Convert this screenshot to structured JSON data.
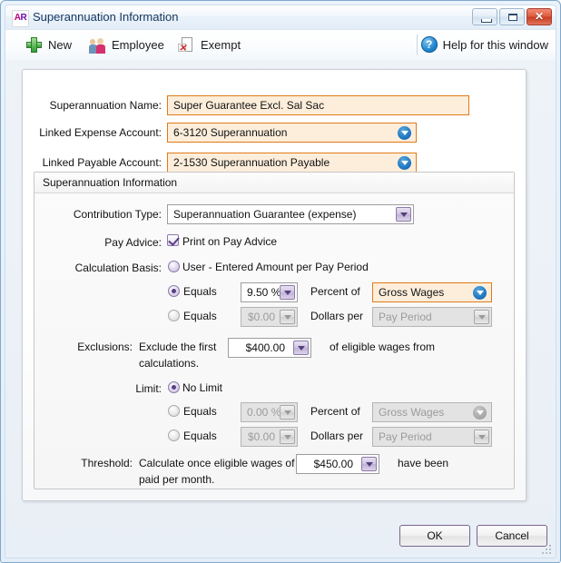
{
  "window": {
    "app_icon_text": "AR",
    "title": "Superannuation Information",
    "controls": {
      "minimize": "minimize-button",
      "maximize": "maximize-button",
      "close": "✕"
    }
  },
  "toolbar": {
    "new_label": "New",
    "employee_label": "Employee",
    "exempt_label": "Exempt",
    "help_label": "Help for this window",
    "help_glyph": "?"
  },
  "form": {
    "name_label": "Superannuation Name:",
    "name_value": "Super Guarantee Excl. Sal Sac",
    "expense_label": "Linked Expense Account:",
    "expense_value": "6-3120 Superannuation",
    "payable_label": "Linked Payable Account:",
    "payable_value": "2-1530 Superannuation Payable"
  },
  "group": {
    "title": "Superannuation Information",
    "contribution_label": "Contribution Type:",
    "contribution_value": "Superannuation Guarantee (expense)",
    "pay_advice_label": "Pay Advice:",
    "pay_advice_checkbox_label": "Print on Pay Advice",
    "calc_label": "Calculation Basis:",
    "calc_option_user": "User  - Entered Amount per Pay Period",
    "calc_equals_1": "Equals",
    "calc_percent_value": "9.50 %",
    "calc_percent_of_label": "Percent of",
    "calc_percent_of_value": "Gross Wages",
    "calc_equals_2": "Equals",
    "calc_dollars_value": "$0.00",
    "calc_dollars_per_label": "Dollars per",
    "calc_dollars_per_value": "Pay Period",
    "exclusions_label": "Exclusions:",
    "exclusions_prefix": "Exclude the first",
    "exclusions_value": "$400.00",
    "exclusions_suffix": "of eligible wages from",
    "exclusions_suffix2": "calculations.",
    "limit_label": "Limit:",
    "limit_option_none": "No Limit",
    "limit_equals_1": "Equals",
    "limit_percent_value": "0.00 %",
    "limit_percent_of_label": "Percent of",
    "limit_percent_of_value": "Gross Wages",
    "limit_equals_2": "Equals",
    "limit_dollars_value": "$0.00",
    "limit_dollars_per_label": "Dollars per",
    "limit_dollars_per_value": "Pay Period",
    "threshold_label": "Threshold:",
    "threshold_prefix": "Calculate once eligible wages of",
    "threshold_value": "$450.00",
    "threshold_suffix": "have been",
    "threshold_suffix2": "paid per month."
  },
  "footer": {
    "ok_label": "OK",
    "cancel_label": "Cancel"
  },
  "colors": {
    "field_border_active": "#e07a18",
    "field_bg_active": "#fdeedb",
    "accent_purple": "#5b3f86",
    "accent_blue": "#1f78c2",
    "title_text": "#13365e"
  }
}
